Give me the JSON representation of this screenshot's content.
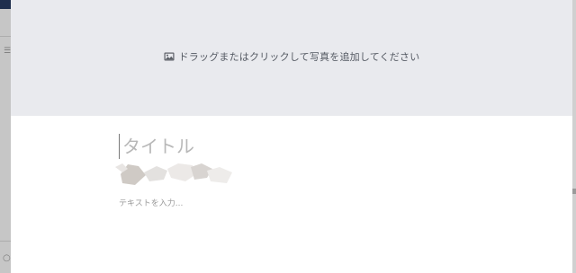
{
  "photo_upload": {
    "label": "ドラッグまたはクリックして写真を追加してください",
    "icon": "image-icon"
  },
  "editor": {
    "title_placeholder": "タイトル",
    "body_placeholder": "テキストを入力..."
  },
  "colors": {
    "upload_area_bg": "#e9eaee",
    "upload_text": "#555a63",
    "placeholder": "#b8b8b8",
    "overlay": "#bfbfbf"
  }
}
